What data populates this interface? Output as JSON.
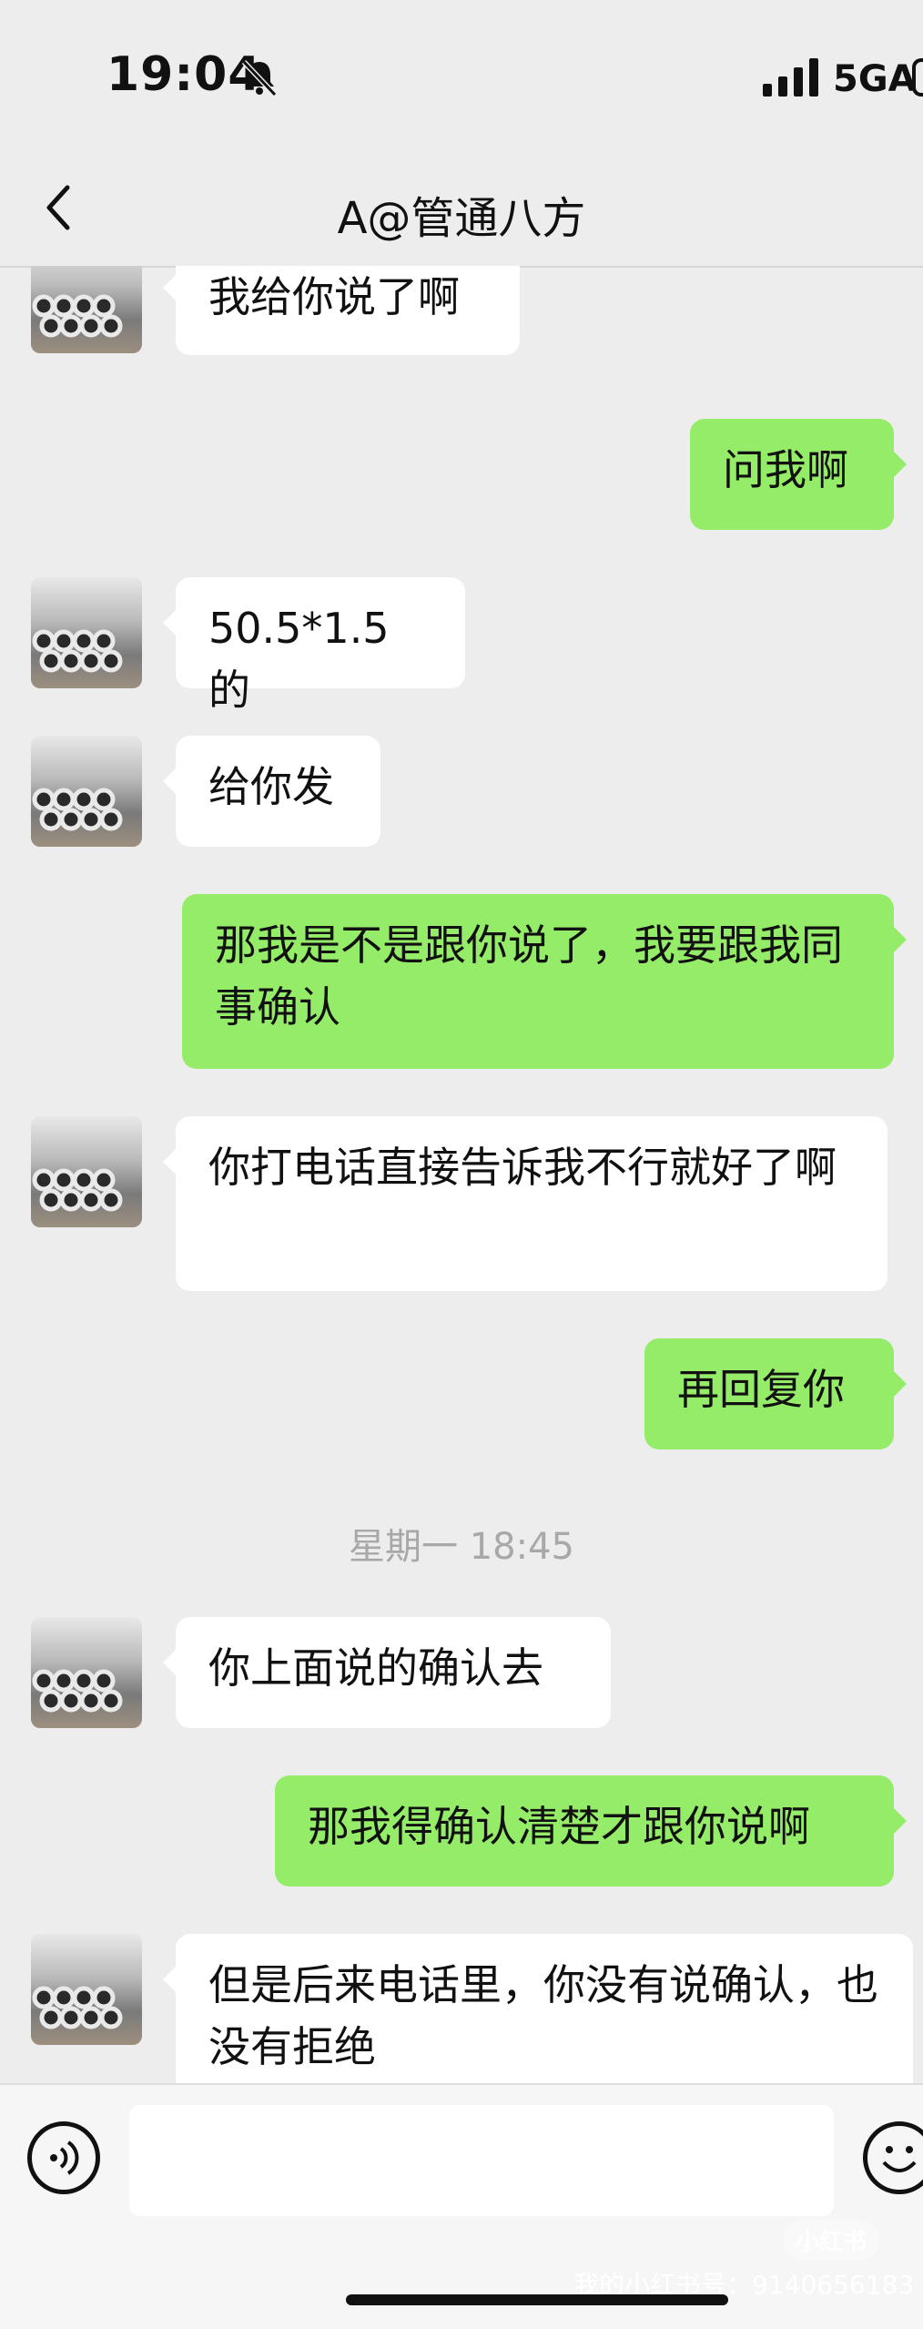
{
  "status": {
    "time": "19:04",
    "network": "5GA"
  },
  "nav": {
    "title": "A@管通八方"
  },
  "messages": [
    {
      "side": "left",
      "text": "我给你说了啊"
    },
    {
      "side": "right",
      "text": "问我啊"
    },
    {
      "side": "left",
      "text": "50.5*1.5 的"
    },
    {
      "side": "left",
      "text": "给你发"
    },
    {
      "side": "right",
      "text": "那我是不是跟你说了，我要跟我同事确认"
    },
    {
      "side": "left",
      "text": "你打电话直接告诉我不行就好了啊"
    },
    {
      "side": "right",
      "text": "再回复你"
    },
    {
      "side": "left",
      "text": "你上面说的确认去"
    },
    {
      "side": "right",
      "text": "那我得确认清楚才跟你说啊"
    },
    {
      "side": "left",
      "text": "但是后来电话里，你没有说确认，也没有拒绝"
    }
  ],
  "timestamp": "星期一 18:45",
  "input": {
    "placeholder": ""
  },
  "watermark": {
    "logo": "小红书",
    "id": "我的小红书号：9140656183"
  },
  "colors": {
    "bubble_right": "#95ec69",
    "bubble_left": "#ffffff",
    "background": "#ededed"
  }
}
